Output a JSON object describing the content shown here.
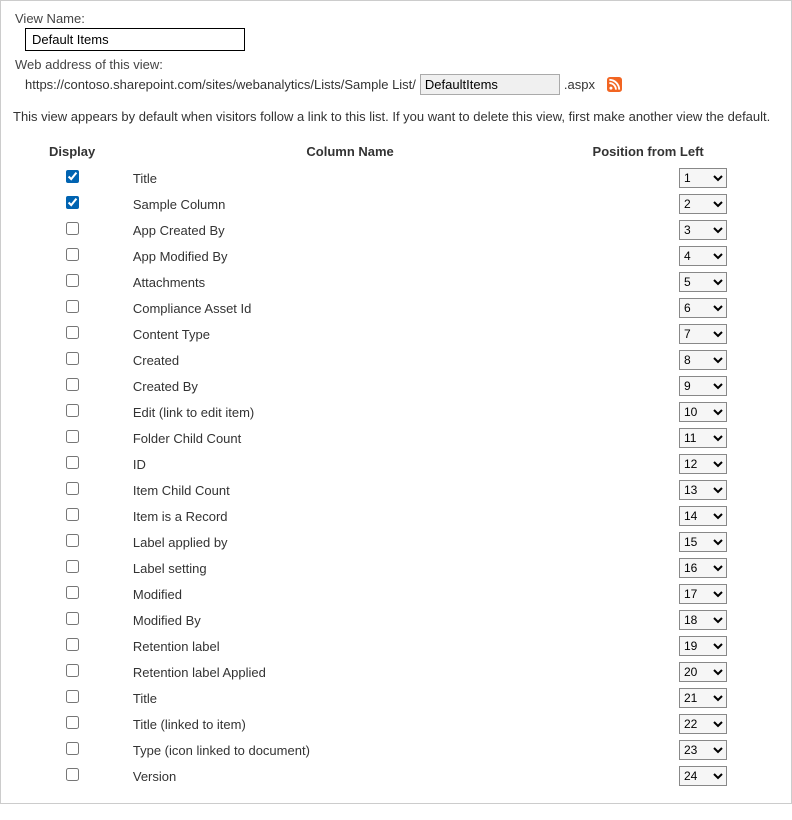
{
  "labels": {
    "view_name": "View Name:",
    "web_address": "Web address of this view:"
  },
  "view_name_value": "Default Items",
  "url_prefix": "https://contoso.sharepoint.com/sites/webanalytics/Lists/Sample List/",
  "url_slug": "DefaultItems",
  "url_suffix": ".aspx",
  "description": "This view appears by default when visitors follow a link to this list. If you want to delete this view, first make another view the default.",
  "headers": {
    "display": "Display",
    "column": "Column Name",
    "position": "Position from Left"
  },
  "columns": [
    {
      "name": "Title",
      "checked": true,
      "pos": 1
    },
    {
      "name": "Sample Column",
      "checked": true,
      "pos": 2
    },
    {
      "name": "App Created By",
      "checked": false,
      "pos": 3
    },
    {
      "name": "App Modified By",
      "checked": false,
      "pos": 4
    },
    {
      "name": "Attachments",
      "checked": false,
      "pos": 5
    },
    {
      "name": "Compliance Asset Id",
      "checked": false,
      "pos": 6
    },
    {
      "name": "Content Type",
      "checked": false,
      "pos": 7
    },
    {
      "name": "Created",
      "checked": false,
      "pos": 8
    },
    {
      "name": "Created By",
      "checked": false,
      "pos": 9
    },
    {
      "name": "Edit (link to edit item)",
      "checked": false,
      "pos": 10
    },
    {
      "name": "Folder Child Count",
      "checked": false,
      "pos": 11
    },
    {
      "name": "ID",
      "checked": false,
      "pos": 12
    },
    {
      "name": "Item Child Count",
      "checked": false,
      "pos": 13
    },
    {
      "name": "Item is a Record",
      "checked": false,
      "pos": 14
    },
    {
      "name": "Label applied by",
      "checked": false,
      "pos": 15
    },
    {
      "name": "Label setting",
      "checked": false,
      "pos": 16
    },
    {
      "name": "Modified",
      "checked": false,
      "pos": 17
    },
    {
      "name": "Modified By",
      "checked": false,
      "pos": 18
    },
    {
      "name": "Retention label",
      "checked": false,
      "pos": 19
    },
    {
      "name": "Retention label Applied",
      "checked": false,
      "pos": 20
    },
    {
      "name": "Title",
      "checked": false,
      "pos": 21
    },
    {
      "name": "Title (linked to item)",
      "checked": false,
      "pos": 22
    },
    {
      "name": "Type (icon linked to document)",
      "checked": false,
      "pos": 23
    },
    {
      "name": "Version",
      "checked": false,
      "pos": 24
    }
  ]
}
